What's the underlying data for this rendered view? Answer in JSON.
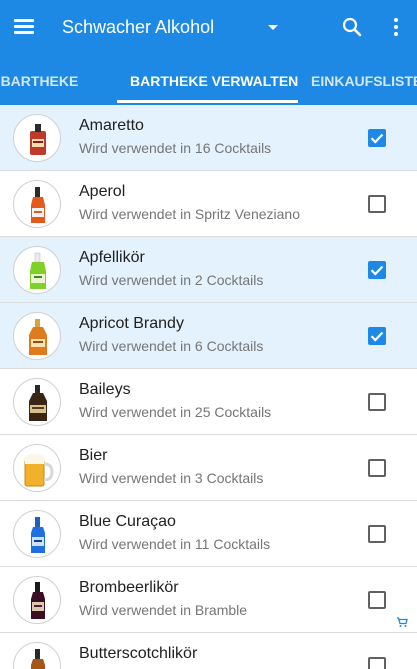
{
  "appbar": {
    "title": "Schwacher Alkohol",
    "bg_color": "#1e88e5",
    "icons": [
      "menu-icon",
      "dropdown-arrow-icon",
      "search-icon",
      "more-vert-icon"
    ]
  },
  "tabs": [
    {
      "label": "EINE BARTHEKE",
      "selected": false
    },
    {
      "label": "BARTHEKE VERWALTEN",
      "selected": true
    },
    {
      "label": "EINKAUFSLISTE",
      "selected": false
    }
  ],
  "items": [
    {
      "name": "Amaretto",
      "subtitle": "Wird verwendet in 16 Cocktails",
      "checked": true,
      "bottle": "amaretto",
      "cart": false
    },
    {
      "name": "Aperol",
      "subtitle": "Wird verwendet in Spritz Veneziano",
      "checked": false,
      "bottle": "aperol",
      "cart": false
    },
    {
      "name": "Apfellikör",
      "subtitle": "Wird verwendet in 2 Cocktails",
      "checked": true,
      "bottle": "apfel",
      "cart": false
    },
    {
      "name": "Apricot Brandy",
      "subtitle": "Wird verwendet in 6 Cocktails",
      "checked": true,
      "bottle": "apricot",
      "cart": false
    },
    {
      "name": "Baileys",
      "subtitle": "Wird verwendet in 25 Cocktails",
      "checked": false,
      "bottle": "baileys",
      "cart": false
    },
    {
      "name": "Bier",
      "subtitle": "Wird verwendet in 3 Cocktails",
      "checked": false,
      "bottle": "bier",
      "cart": false
    },
    {
      "name": "Blue Curaçao",
      "subtitle": "Wird verwendet in 11 Cocktails",
      "checked": false,
      "bottle": "blue",
      "cart": false
    },
    {
      "name": "Brombeerlikör",
      "subtitle": "Wird verwendet in Bramble",
      "checked": false,
      "bottle": "brombeer",
      "cart": true
    },
    {
      "name": "Butterscotchlikör",
      "subtitle": "",
      "checked": false,
      "bottle": "butterscotch",
      "cart": false
    }
  ],
  "colors": {
    "accent": "#1e88e5",
    "selected_row": "#e3f2fd",
    "divider": "#dcdcdc"
  }
}
